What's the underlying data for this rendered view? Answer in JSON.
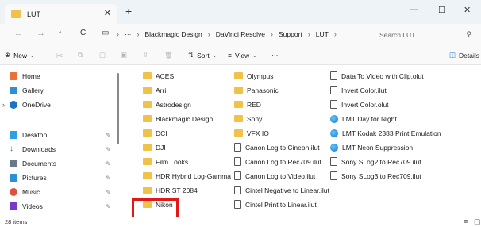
{
  "tab": {
    "title": "LUT",
    "close": "✕",
    "new": "+"
  },
  "window": {
    "minimize": "—",
    "maximize": "☐",
    "close": "✕"
  },
  "nav": {
    "back": "←",
    "forward": "→",
    "up": "↑",
    "refresh": "C",
    "more": "···"
  },
  "breadcrumbs": [
    "Blackmagic Design",
    "DaVinci Resolve",
    "Support",
    "LUT"
  ],
  "search": {
    "placeholder": "Search LUT"
  },
  "commands": {
    "new": "New",
    "sort": "Sort",
    "view": "View",
    "more": "···",
    "details": "Details"
  },
  "sidebar": {
    "items": [
      {
        "label": "Home",
        "icon": "home-icon",
        "color": "#e8733a"
      },
      {
        "label": "Gallery",
        "icon": "gallery-icon",
        "color": "#2d8fd6"
      },
      {
        "label": "OneDrive",
        "icon": "cloud-icon",
        "color": "#1a73c9"
      },
      {
        "label": "Desktop",
        "icon": "desktop-icon",
        "color": "#2d9fe6"
      },
      {
        "label": "Downloads",
        "icon": "download-icon",
        "color": "#1a8a3a"
      },
      {
        "label": "Documents",
        "icon": "documents-icon",
        "color": "#6a7a8a"
      },
      {
        "label": "Pictures",
        "icon": "pictures-icon",
        "color": "#2d8fd6"
      },
      {
        "label": "Music",
        "icon": "music-icon",
        "color": "#e0503a"
      },
      {
        "label": "Videos",
        "icon": "videos-icon",
        "color": "#7a3ac8"
      }
    ]
  },
  "files": {
    "col1": [
      "ACES",
      "Arri",
      "Astrodesign",
      "Blackmagic Design",
      "DCI",
      "DJI",
      "Film Looks",
      "HDR Hybrid Log-Gamma",
      "HDR ST 2084",
      "Nikon"
    ],
    "col2_folders": [
      "Olympus",
      "Panasonic",
      "RED",
      "Sony",
      "VFX IO"
    ],
    "col2_files": [
      "Canon Log to Cineon.ilut",
      "Canon Log to Rec709.ilut",
      "Canon Log to Video.ilut",
      "Cintel Negative to Linear.ilut",
      "Cintel Print to Linear.ilut"
    ],
    "col3_files": [
      "Data To Video with Clip.olut",
      "Invert Color.ilut",
      "Invert Color.olut"
    ],
    "col3_special": [
      "LMT Day for Night",
      "LMT Kodak 2383 Print Emulation",
      "LMT Neon Suppression"
    ],
    "col3_files2": [
      "Sony SLog2 to Rec709.ilut",
      "Sony SLog3 to Rec709.ilut"
    ]
  },
  "status": {
    "count": "28 items"
  }
}
